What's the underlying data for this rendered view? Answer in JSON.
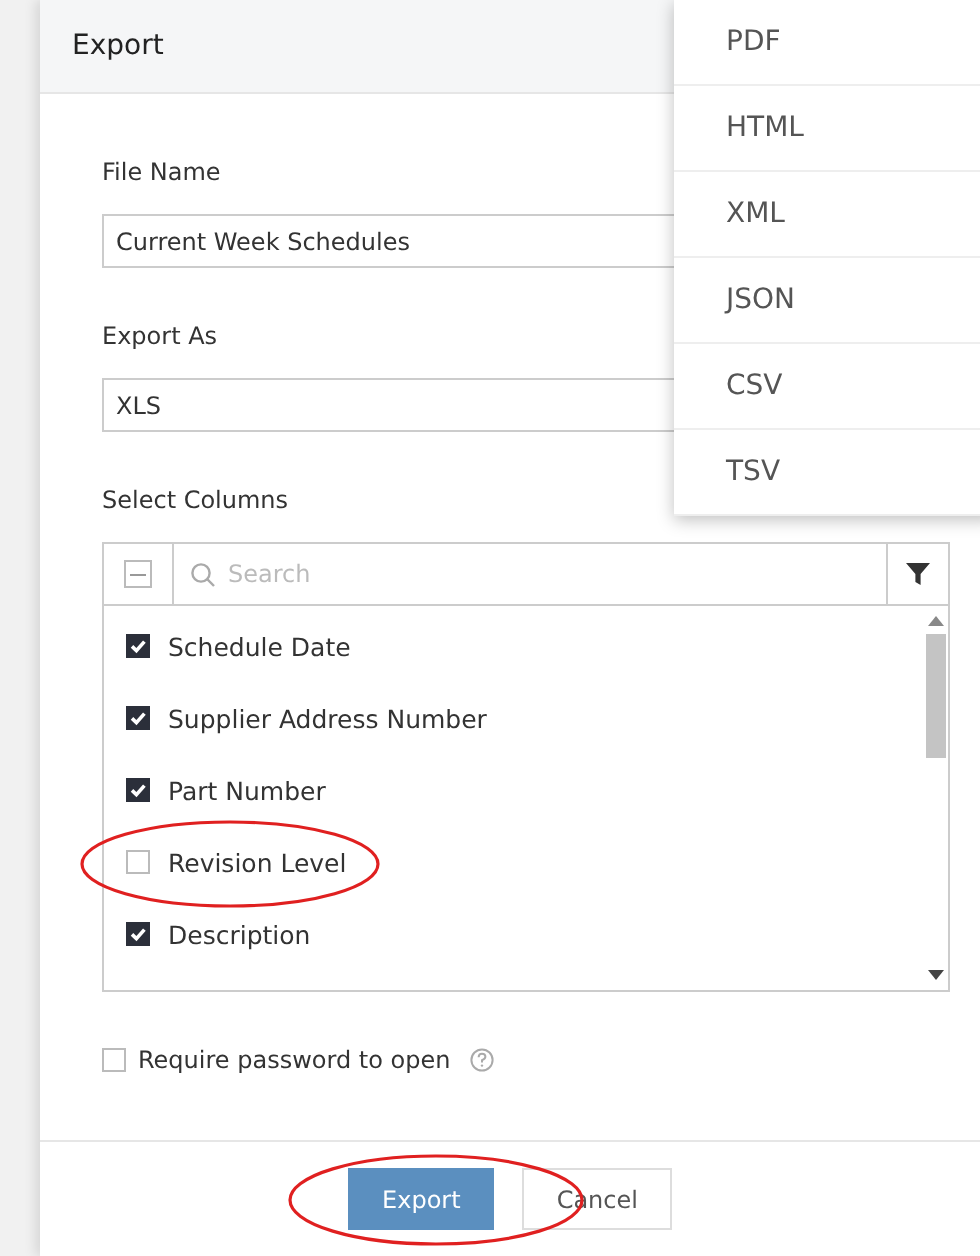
{
  "dialog": {
    "title": "Export"
  },
  "file_name": {
    "label": "File Name",
    "value": "Current Week Schedules"
  },
  "export_as": {
    "label": "Export As",
    "value": "XLS",
    "menu": [
      "PDF",
      "HTML",
      "XML",
      "JSON",
      "CSV",
      "TSV"
    ]
  },
  "select_columns": {
    "label": "Select Columns",
    "search_placeholder": "Search",
    "select_all_indeterminate": true,
    "columns": [
      {
        "label": "Schedule Date",
        "checked": true
      },
      {
        "label": "Supplier Address Number",
        "checked": true
      },
      {
        "label": "Part Number",
        "checked": true
      },
      {
        "label": "Revision Level",
        "checked": false
      },
      {
        "label": "Description",
        "checked": true
      }
    ]
  },
  "password": {
    "label": "Require password to open",
    "checked": false
  },
  "buttons": {
    "primary": "Export",
    "secondary": "Cancel"
  }
}
